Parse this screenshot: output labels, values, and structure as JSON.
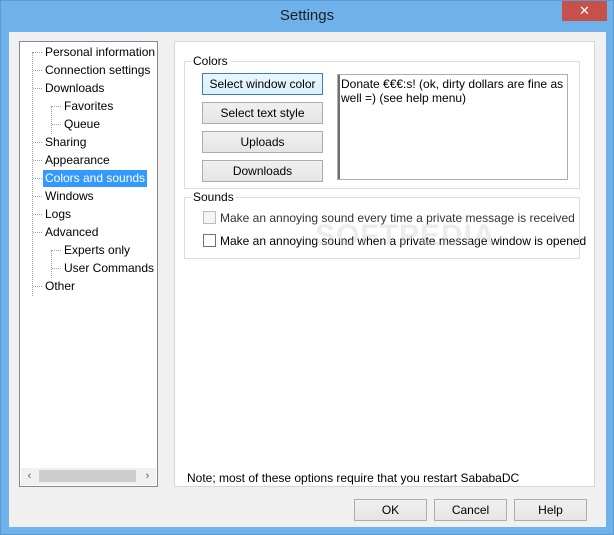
{
  "window": {
    "title": "Settings",
    "close_glyph": "✕"
  },
  "tree": {
    "items": [
      {
        "label": "Personal information",
        "level": 0
      },
      {
        "label": "Connection settings",
        "level": 0
      },
      {
        "label": "Downloads",
        "level": 0
      },
      {
        "label": "Favorites",
        "level": 1
      },
      {
        "label": "Queue",
        "level": 1
      },
      {
        "label": "Sharing",
        "level": 0
      },
      {
        "label": "Appearance",
        "level": 0
      },
      {
        "label": "Colors and sounds",
        "level": 0,
        "selected": true
      },
      {
        "label": "Windows",
        "level": 0
      },
      {
        "label": "Logs",
        "level": 0
      },
      {
        "label": "Advanced",
        "level": 0
      },
      {
        "label": "Experts only",
        "level": 1
      },
      {
        "label": "User Commands",
        "level": 1
      },
      {
        "label": "Other",
        "level": 0
      }
    ],
    "scroll_left": "‹",
    "scroll_right": "›"
  },
  "colors": {
    "group_title": "Colors",
    "buttons": [
      "Select window color",
      "Select text style",
      "Uploads",
      "Downloads"
    ],
    "preview_text": "Donate €€€:s! (ok, dirty dollars are fine as well =) (see help menu)"
  },
  "sounds": {
    "group_title": "Sounds",
    "options": [
      {
        "label": "Make an annoying sound every time a private message is received",
        "checked": false,
        "enabled": false
      },
      {
        "label": "Make an annoying sound when a private message window is opened",
        "checked": false,
        "enabled": true
      }
    ]
  },
  "note": "Note; most of these options require that you restart SababaDC",
  "watermark": "SOFTPEDIA",
  "footer": {
    "ok": "OK",
    "cancel": "Cancel",
    "help": "Help"
  },
  "theme": {
    "title_bar": "#6fb1ea",
    "selection": "#3399ff",
    "close": "#c7504b"
  }
}
